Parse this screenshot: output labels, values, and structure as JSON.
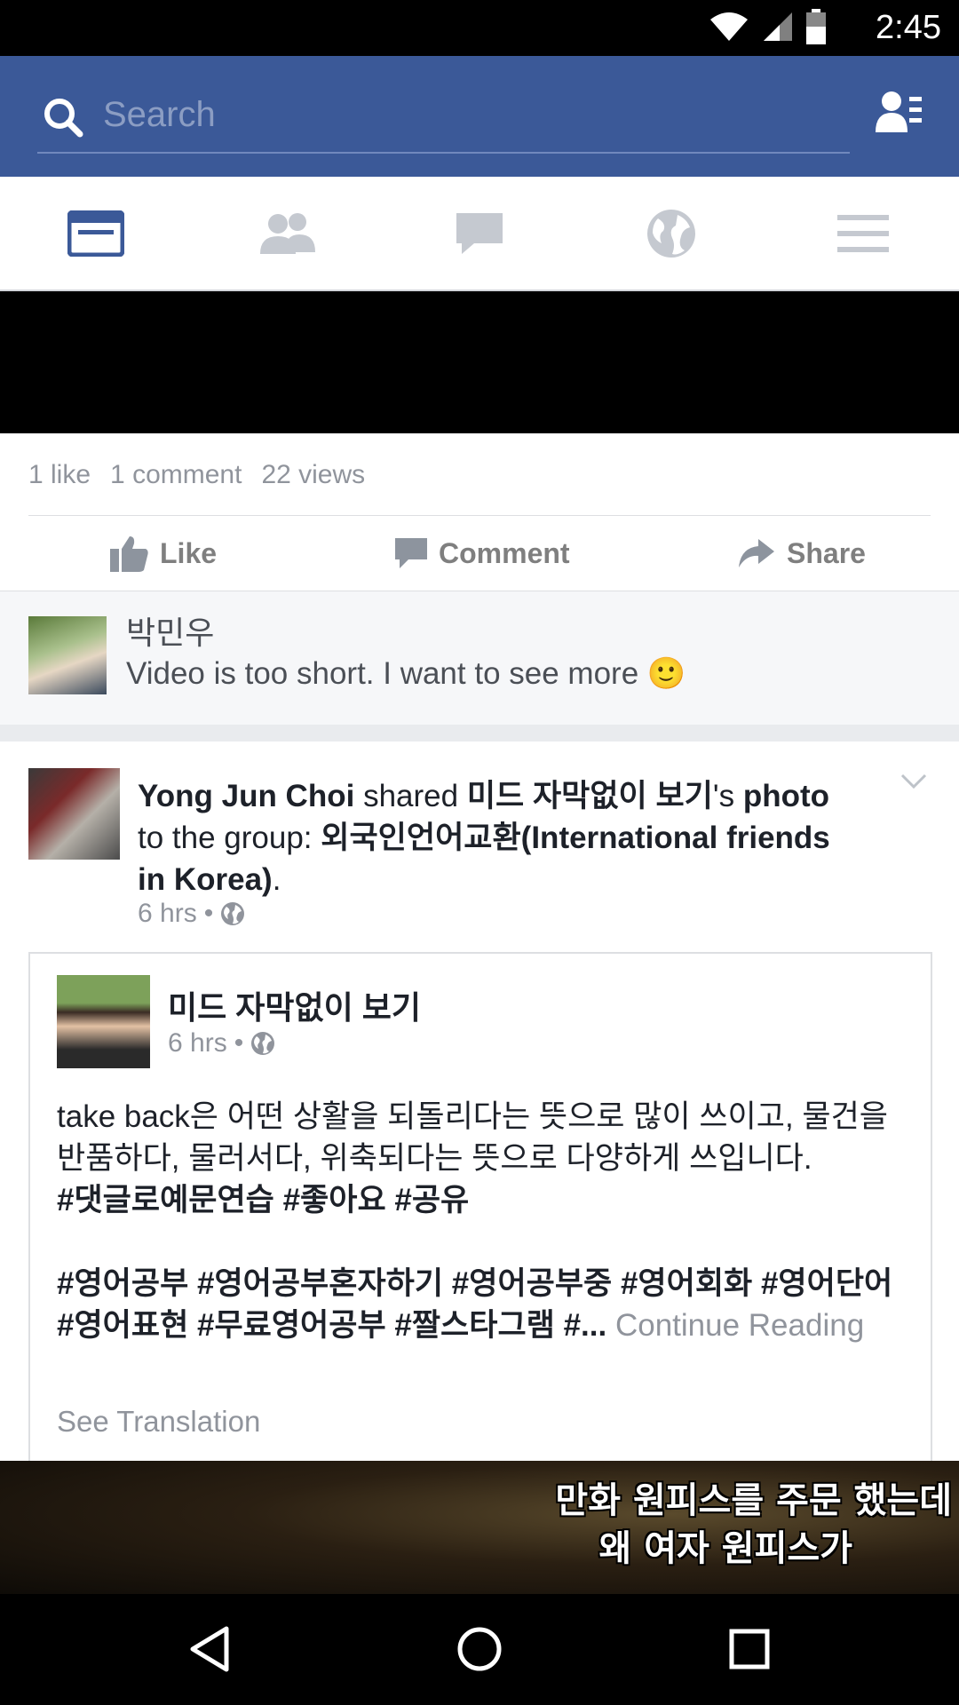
{
  "status_bar": {
    "time": "2:45"
  },
  "search": {
    "placeholder": "Search"
  },
  "tabs": [
    {
      "name": "news-feed",
      "active": true
    },
    {
      "name": "friends",
      "active": false
    },
    {
      "name": "messages",
      "active": false
    },
    {
      "name": "notifications",
      "active": false
    },
    {
      "name": "more",
      "active": false
    }
  ],
  "post1": {
    "likes": "1 like",
    "comments": "1 comment",
    "views": "22 views",
    "actions": {
      "like": "Like",
      "comment": "Comment",
      "share": "Share"
    },
    "comment": {
      "author": "박민우",
      "text": "Video is too short. I want to see more 🙂"
    }
  },
  "post2": {
    "sharer": "Yong Jun Choi",
    "shared_word": "shared",
    "page_ref": "미드 자막없이 보기",
    "possessive": "'s",
    "photo_word": "photo",
    "to_group": "to the group:",
    "group_name": "외국인언어교환(International friends in Korea)",
    "period": ".",
    "time": "6 hrs",
    "dot": "•",
    "inner": {
      "page_name": "미드 자막없이 보기",
      "time": "6 hrs",
      "dot": "•",
      "text1": "take back은 어떤 상활을 되돌리다는 뜻으로 많이 쓰이고, 물건을 반품하다, 물러서다, 위축되다는 뜻으로 다양하게 쓰입니다.",
      "tags1": "#댓글로예문연습 #좋아요 #공유",
      "tags2": "#영어공부 #영어공부혼자하기 #영어공부중 #영어회화 #영어단어 #영어표현 #무료영어공부 #짤스타그램 #...",
      "continue": "Continue Reading",
      "see_translation": "See Translation"
    },
    "image_subtitles": [
      "만화 원피스를 주문 했는데",
      "왜 여자 원피스가"
    ]
  },
  "colors": {
    "brand": "#3b5998",
    "muted": "#90949c"
  }
}
